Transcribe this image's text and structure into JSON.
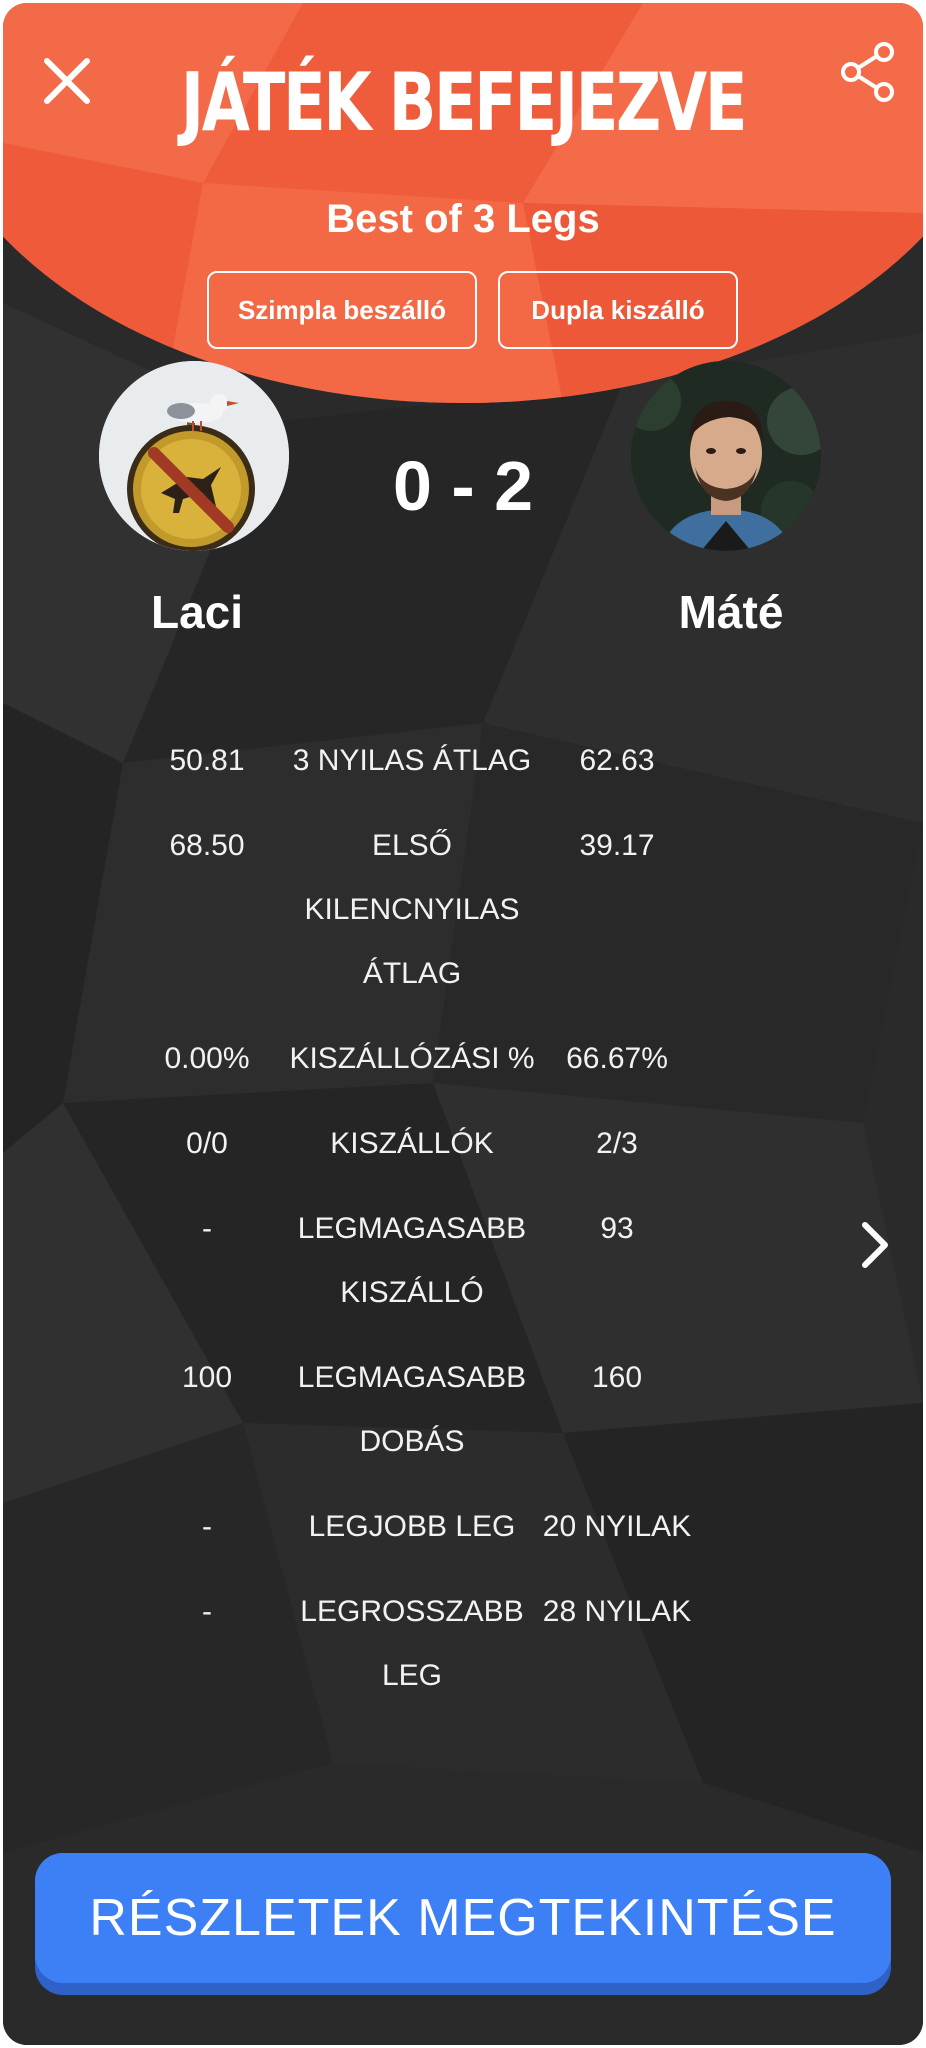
{
  "header": {
    "title": "JÁTÉK BEFEJEZVE",
    "subtitle": "Best of 3 Legs",
    "check_in_mode": "Szimpla beszálló",
    "check_out_mode": "Dupla kiszálló",
    "accent_color": "#f2603f"
  },
  "score": "0 - 2",
  "players": {
    "left": {
      "name": "Laci"
    },
    "right": {
      "name": "Máté"
    }
  },
  "stats": [
    {
      "left": "50.81",
      "label": "3 NYILAS ÁTLAG",
      "right": "62.63"
    },
    {
      "left": "68.50",
      "label": "ELSŐ KILENCNYILAS ÁTLAG",
      "right": "39.17"
    },
    {
      "left": "0.00%",
      "label": "KISZÁLLÓZÁSI %",
      "right": "66.67%"
    },
    {
      "left": "0/0",
      "label": "KISZÁLLÓK",
      "right": "2/3"
    },
    {
      "left": "-",
      "label": "LEGMAGASABB KISZÁLLÓ",
      "right": "93"
    },
    {
      "left": "100",
      "label": "LEGMAGASABB DOBÁS",
      "right": "160"
    },
    {
      "left": "-",
      "label": "LEGJOBB LEG",
      "right": "20 NYILAK"
    },
    {
      "left": "-",
      "label": "LEGROSSZABB LEG",
      "right": "28 NYILAK"
    }
  ],
  "details_button": "RÉSZLETEK MEGTEKINTÉSE",
  "icons": {
    "close": "close-icon",
    "share": "share-icon",
    "next": "chevron-right-icon"
  },
  "colors": {
    "background": "#2a2a2a",
    "button": "#3d7ff5"
  }
}
